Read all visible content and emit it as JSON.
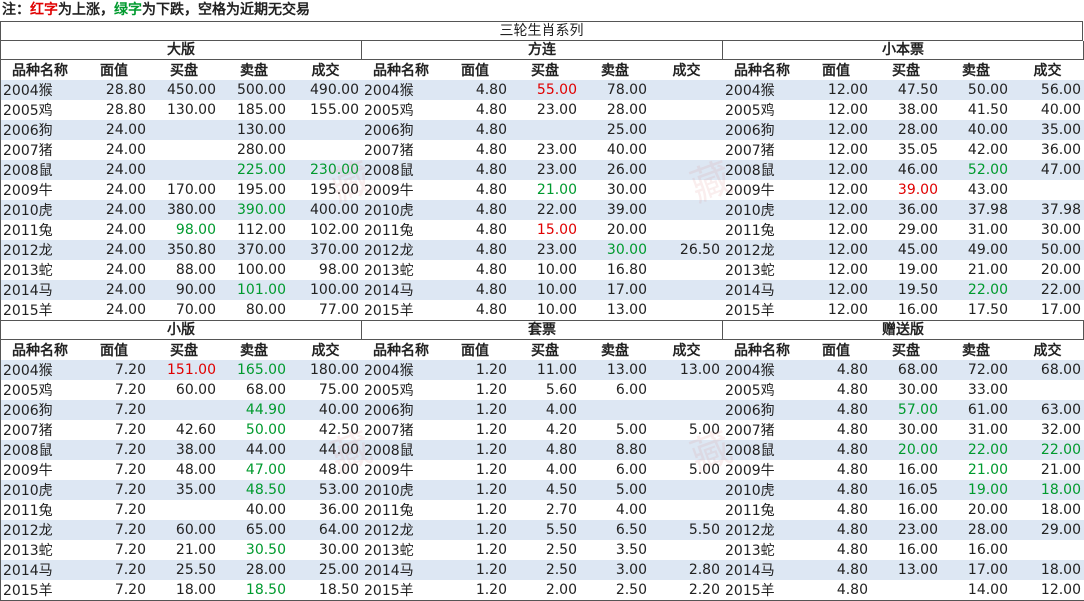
{
  "note": {
    "prefix": "注：",
    "red_word": "红字",
    "mid1": "为上涨，",
    "green_word": "绿字",
    "mid2": "为下跌，空格为近期无交易"
  },
  "title": "三轮生肖系列",
  "headers": [
    "品种名称",
    "面值",
    "买盘",
    "卖盘",
    "成交"
  ],
  "colors": {
    "up": "#e00000",
    "down": "#009a2e",
    "stripe": "#dde7f3"
  },
  "watermark": "藏",
  "panels": [
    {
      "title": "大版",
      "rows": [
        {
          "name": "2004猴",
          "face": "28.80",
          "bid": "450.00",
          "ask": "500.00",
          "deal": "490.00",
          "bid_t": "",
          "ask_t": "",
          "deal_t": ""
        },
        {
          "name": "2005鸡",
          "face": "28.80",
          "bid": "130.00",
          "ask": "185.00",
          "deal": "155.00",
          "bid_t": "",
          "ask_t": "",
          "deal_t": ""
        },
        {
          "name": "2006狗",
          "face": "24.00",
          "bid": "",
          "ask": "130.00",
          "deal": "",
          "bid_t": "",
          "ask_t": "",
          "deal_t": ""
        },
        {
          "name": "2007猪",
          "face": "24.00",
          "bid": "",
          "ask": "280.00",
          "deal": "",
          "bid_t": "",
          "ask_t": "",
          "deal_t": ""
        },
        {
          "name": "2008鼠",
          "face": "24.00",
          "bid": "",
          "ask": "225.00",
          "deal": "230.00",
          "bid_t": "",
          "ask_t": "down",
          "deal_t": "down"
        },
        {
          "name": "2009牛",
          "face": "24.00",
          "bid": "170.00",
          "ask": "195.00",
          "deal": "195.00",
          "bid_t": "",
          "ask_t": "",
          "deal_t": ""
        },
        {
          "name": "2010虎",
          "face": "24.00",
          "bid": "380.00",
          "ask": "390.00",
          "deal": "400.00",
          "bid_t": "",
          "ask_t": "down",
          "deal_t": ""
        },
        {
          "name": "2011兔",
          "face": "24.00",
          "bid": "98.00",
          "ask": "112.00",
          "deal": "102.00",
          "bid_t": "down",
          "ask_t": "",
          "deal_t": ""
        },
        {
          "name": "2012龙",
          "face": "24.00",
          "bid": "350.80",
          "ask": "370.00",
          "deal": "370.00",
          "bid_t": "",
          "ask_t": "",
          "deal_t": ""
        },
        {
          "name": "2013蛇",
          "face": "24.00",
          "bid": "88.00",
          "ask": "100.00",
          "deal": "98.00",
          "bid_t": "",
          "ask_t": "",
          "deal_t": ""
        },
        {
          "name": "2014马",
          "face": "24.00",
          "bid": "90.00",
          "ask": "101.00",
          "deal": "100.00",
          "bid_t": "",
          "ask_t": "down",
          "deal_t": ""
        },
        {
          "name": "2015羊",
          "face": "24.00",
          "bid": "70.00",
          "ask": "80.00",
          "deal": "77.00",
          "bid_t": "",
          "ask_t": "",
          "deal_t": ""
        }
      ]
    },
    {
      "title": "方连",
      "rows": [
        {
          "name": "2004猴",
          "face": "4.80",
          "bid": "55.00",
          "ask": "78.00",
          "deal": "",
          "bid_t": "up",
          "ask_t": "",
          "deal_t": ""
        },
        {
          "name": "2005鸡",
          "face": "4.80",
          "bid": "23.00",
          "ask": "28.00",
          "deal": "",
          "bid_t": "",
          "ask_t": "",
          "deal_t": ""
        },
        {
          "name": "2006狗",
          "face": "4.80",
          "bid": "",
          "ask": "25.00",
          "deal": "",
          "bid_t": "",
          "ask_t": "",
          "deal_t": ""
        },
        {
          "name": "2007猪",
          "face": "4.80",
          "bid": "23.00",
          "ask": "40.00",
          "deal": "",
          "bid_t": "",
          "ask_t": "",
          "deal_t": ""
        },
        {
          "name": "2008鼠",
          "face": "4.80",
          "bid": "23.00",
          "ask": "26.00",
          "deal": "",
          "bid_t": "",
          "ask_t": "",
          "deal_t": ""
        },
        {
          "name": "2009牛",
          "face": "4.80",
          "bid": "21.00",
          "ask": "30.00",
          "deal": "",
          "bid_t": "down",
          "ask_t": "",
          "deal_t": ""
        },
        {
          "name": "2010虎",
          "face": "4.80",
          "bid": "22.00",
          "ask": "39.00",
          "deal": "",
          "bid_t": "",
          "ask_t": "",
          "deal_t": ""
        },
        {
          "name": "2011兔",
          "face": "4.80",
          "bid": "15.00",
          "ask": "20.00",
          "deal": "",
          "bid_t": "up",
          "ask_t": "",
          "deal_t": ""
        },
        {
          "name": "2012龙",
          "face": "4.80",
          "bid": "23.00",
          "ask": "30.00",
          "deal": "26.50",
          "bid_t": "",
          "ask_t": "down",
          "deal_t": ""
        },
        {
          "name": "2013蛇",
          "face": "4.80",
          "bid": "10.00",
          "ask": "16.80",
          "deal": "",
          "bid_t": "",
          "ask_t": "",
          "deal_t": ""
        },
        {
          "name": "2014马",
          "face": "4.80",
          "bid": "10.00",
          "ask": "17.00",
          "deal": "",
          "bid_t": "",
          "ask_t": "",
          "deal_t": ""
        },
        {
          "name": "2015羊",
          "face": "4.80",
          "bid": "10.00",
          "ask": "13.00",
          "deal": "",
          "bid_t": "",
          "ask_t": "",
          "deal_t": ""
        }
      ]
    },
    {
      "title": "小本票",
      "rows": [
        {
          "name": "2004猴",
          "face": "12.00",
          "bid": "47.50",
          "ask": "50.00",
          "deal": "56.00",
          "bid_t": "",
          "ask_t": "",
          "deal_t": ""
        },
        {
          "name": "2005鸡",
          "face": "12.00",
          "bid": "38.00",
          "ask": "41.50",
          "deal": "40.00",
          "bid_t": "",
          "ask_t": "",
          "deal_t": ""
        },
        {
          "name": "2006狗",
          "face": "12.00",
          "bid": "28.00",
          "ask": "40.00",
          "deal": "35.00",
          "bid_t": "",
          "ask_t": "",
          "deal_t": ""
        },
        {
          "name": "2007猪",
          "face": "12.00",
          "bid": "35.05",
          "ask": "42.00",
          "deal": "36.00",
          "bid_t": "",
          "ask_t": "",
          "deal_t": ""
        },
        {
          "name": "2008鼠",
          "face": "12.00",
          "bid": "46.00",
          "ask": "52.00",
          "deal": "47.00",
          "bid_t": "",
          "ask_t": "down",
          "deal_t": ""
        },
        {
          "name": "2009牛",
          "face": "12.00",
          "bid": "39.00",
          "ask": "43.00",
          "deal": "",
          "bid_t": "up",
          "ask_t": "",
          "deal_t": ""
        },
        {
          "name": "2010虎",
          "face": "12.00",
          "bid": "36.00",
          "ask": "37.98",
          "deal": "37.98",
          "bid_t": "",
          "ask_t": "",
          "deal_t": ""
        },
        {
          "name": "2011兔",
          "face": "12.00",
          "bid": "29.00",
          "ask": "31.00",
          "deal": "30.00",
          "bid_t": "",
          "ask_t": "",
          "deal_t": ""
        },
        {
          "name": "2012龙",
          "face": "12.00",
          "bid": "45.00",
          "ask": "49.00",
          "deal": "50.00",
          "bid_t": "",
          "ask_t": "",
          "deal_t": ""
        },
        {
          "name": "2013蛇",
          "face": "12.00",
          "bid": "19.00",
          "ask": "21.00",
          "deal": "20.00",
          "bid_t": "",
          "ask_t": "",
          "deal_t": ""
        },
        {
          "name": "2014马",
          "face": "12.00",
          "bid": "19.50",
          "ask": "22.00",
          "deal": "22.00",
          "bid_t": "",
          "ask_t": "down",
          "deal_t": ""
        },
        {
          "name": "2015羊",
          "face": "12.00",
          "bid": "16.00",
          "ask": "17.50",
          "deal": "17.00",
          "bid_t": "",
          "ask_t": "",
          "deal_t": ""
        }
      ]
    },
    {
      "title": "小版",
      "rows": [
        {
          "name": "2004猴",
          "face": "7.20",
          "bid": "151.00",
          "ask": "165.00",
          "deal": "180.00",
          "bid_t": "up",
          "ask_t": "down",
          "deal_t": ""
        },
        {
          "name": "2005鸡",
          "face": "7.20",
          "bid": "60.00",
          "ask": "68.00",
          "deal": "75.00",
          "bid_t": "",
          "ask_t": "",
          "deal_t": ""
        },
        {
          "name": "2006狗",
          "face": "7.20",
          "bid": "",
          "ask": "44.90",
          "deal": "40.00",
          "bid_t": "",
          "ask_t": "down",
          "deal_t": ""
        },
        {
          "name": "2007猪",
          "face": "7.20",
          "bid": "42.60",
          "ask": "50.00",
          "deal": "42.50",
          "bid_t": "",
          "ask_t": "down",
          "deal_t": ""
        },
        {
          "name": "2008鼠",
          "face": "7.20",
          "bid": "38.00",
          "ask": "44.00",
          "deal": "44.00",
          "bid_t": "",
          "ask_t": "",
          "deal_t": ""
        },
        {
          "name": "2009牛",
          "face": "7.20",
          "bid": "48.00",
          "ask": "47.00",
          "deal": "48.00",
          "bid_t": "",
          "ask_t": "down",
          "deal_t": ""
        },
        {
          "name": "2010虎",
          "face": "7.20",
          "bid": "35.00",
          "ask": "48.50",
          "deal": "53.00",
          "bid_t": "",
          "ask_t": "down",
          "deal_t": ""
        },
        {
          "name": "2011兔",
          "face": "7.20",
          "bid": "",
          "ask": "40.00",
          "deal": "36.00",
          "bid_t": "",
          "ask_t": "",
          "deal_t": ""
        },
        {
          "name": "2012龙",
          "face": "7.20",
          "bid": "60.00",
          "ask": "65.00",
          "deal": "64.00",
          "bid_t": "",
          "ask_t": "",
          "deal_t": ""
        },
        {
          "name": "2013蛇",
          "face": "7.20",
          "bid": "21.00",
          "ask": "30.50",
          "deal": "30.00",
          "bid_t": "",
          "ask_t": "down",
          "deal_t": ""
        },
        {
          "name": "2014马",
          "face": "7.20",
          "bid": "25.50",
          "ask": "28.00",
          "deal": "25.00",
          "bid_t": "",
          "ask_t": "",
          "deal_t": ""
        },
        {
          "name": "2015羊",
          "face": "7.20",
          "bid": "18.00",
          "ask": "18.50",
          "deal": "18.50",
          "bid_t": "",
          "ask_t": "down",
          "deal_t": ""
        }
      ]
    },
    {
      "title": "套票",
      "rows": [
        {
          "name": "2004猴",
          "face": "1.20",
          "bid": "11.00",
          "ask": "13.00",
          "deal": "13.00",
          "bid_t": "",
          "ask_t": "",
          "deal_t": ""
        },
        {
          "name": "2005鸡",
          "face": "1.20",
          "bid": "5.60",
          "ask": "6.00",
          "deal": "",
          "bid_t": "",
          "ask_t": "",
          "deal_t": ""
        },
        {
          "name": "2006狗",
          "face": "1.20",
          "bid": "4.00",
          "ask": "",
          "deal": "",
          "bid_t": "",
          "ask_t": "",
          "deal_t": ""
        },
        {
          "name": "2007猪",
          "face": "1.20",
          "bid": "4.20",
          "ask": "5.00",
          "deal": "5.00",
          "bid_t": "",
          "ask_t": "",
          "deal_t": ""
        },
        {
          "name": "2008鼠",
          "face": "1.20",
          "bid": "4.80",
          "ask": "8.80",
          "deal": "",
          "bid_t": "",
          "ask_t": "",
          "deal_t": ""
        },
        {
          "name": "2009牛",
          "face": "1.20",
          "bid": "4.00",
          "ask": "6.00",
          "deal": "5.00",
          "bid_t": "",
          "ask_t": "",
          "deal_t": ""
        },
        {
          "name": "2010虎",
          "face": "1.20",
          "bid": "4.50",
          "ask": "5.00",
          "deal": "",
          "bid_t": "",
          "ask_t": "",
          "deal_t": ""
        },
        {
          "name": "2011兔",
          "face": "1.20",
          "bid": "2.70",
          "ask": "4.00",
          "deal": "",
          "bid_t": "",
          "ask_t": "",
          "deal_t": ""
        },
        {
          "name": "2012龙",
          "face": "1.20",
          "bid": "5.50",
          "ask": "6.50",
          "deal": "5.50",
          "bid_t": "",
          "ask_t": "",
          "deal_t": ""
        },
        {
          "name": "2013蛇",
          "face": "1.20",
          "bid": "2.50",
          "ask": "3.50",
          "deal": "",
          "bid_t": "",
          "ask_t": "",
          "deal_t": ""
        },
        {
          "name": "2014马",
          "face": "1.20",
          "bid": "2.50",
          "ask": "3.00",
          "deal": "2.80",
          "bid_t": "",
          "ask_t": "",
          "deal_t": ""
        },
        {
          "name": "2015羊",
          "face": "1.20",
          "bid": "2.00",
          "ask": "2.50",
          "deal": "2.20",
          "bid_t": "",
          "ask_t": "",
          "deal_t": ""
        }
      ]
    },
    {
      "title": "赠送版",
      "rows": [
        {
          "name": "2004猴",
          "face": "4.80",
          "bid": "68.00",
          "ask": "72.00",
          "deal": "68.00",
          "bid_t": "",
          "ask_t": "",
          "deal_t": ""
        },
        {
          "name": "2005鸡",
          "face": "4.80",
          "bid": "30.00",
          "ask": "33.00",
          "deal": "",
          "bid_t": "",
          "ask_t": "",
          "deal_t": ""
        },
        {
          "name": "2006狗",
          "face": "4.80",
          "bid": "57.00",
          "ask": "61.00",
          "deal": "63.00",
          "bid_t": "down",
          "ask_t": "",
          "deal_t": ""
        },
        {
          "name": "2007猪",
          "face": "4.80",
          "bid": "30.00",
          "ask": "31.00",
          "deal": "32.00",
          "bid_t": "",
          "ask_t": "",
          "deal_t": ""
        },
        {
          "name": "2008鼠",
          "face": "4.80",
          "bid": "20.00",
          "ask": "22.00",
          "deal": "22.00",
          "bid_t": "down",
          "ask_t": "down",
          "deal_t": "down"
        },
        {
          "name": "2009牛",
          "face": "4.80",
          "bid": "16.00",
          "ask": "21.00",
          "deal": "21.00",
          "bid_t": "",
          "ask_t": "down",
          "deal_t": ""
        },
        {
          "name": "2010虎",
          "face": "4.80",
          "bid": "16.05",
          "ask": "19.00",
          "deal": "18.00",
          "bid_t": "",
          "ask_t": "down",
          "deal_t": "down"
        },
        {
          "name": "2011兔",
          "face": "4.80",
          "bid": "16.00",
          "ask": "20.00",
          "deal": "18.00",
          "bid_t": "",
          "ask_t": "",
          "deal_t": ""
        },
        {
          "name": "2012龙",
          "face": "4.80",
          "bid": "23.00",
          "ask": "28.00",
          "deal": "29.00",
          "bid_t": "",
          "ask_t": "",
          "deal_t": ""
        },
        {
          "name": "2013蛇",
          "face": "4.80",
          "bid": "16.00",
          "ask": "16.00",
          "deal": "",
          "bid_t": "",
          "ask_t": "",
          "deal_t": ""
        },
        {
          "name": "2014马",
          "face": "4.80",
          "bid": "13.00",
          "ask": "17.00",
          "deal": "18.00",
          "bid_t": "",
          "ask_t": "",
          "deal_t": ""
        },
        {
          "name": "2015羊",
          "face": "4.80",
          "bid": "",
          "ask": "14.00",
          "deal": "12.00",
          "bid_t": "",
          "ask_t": "",
          "deal_t": ""
        }
      ]
    }
  ]
}
